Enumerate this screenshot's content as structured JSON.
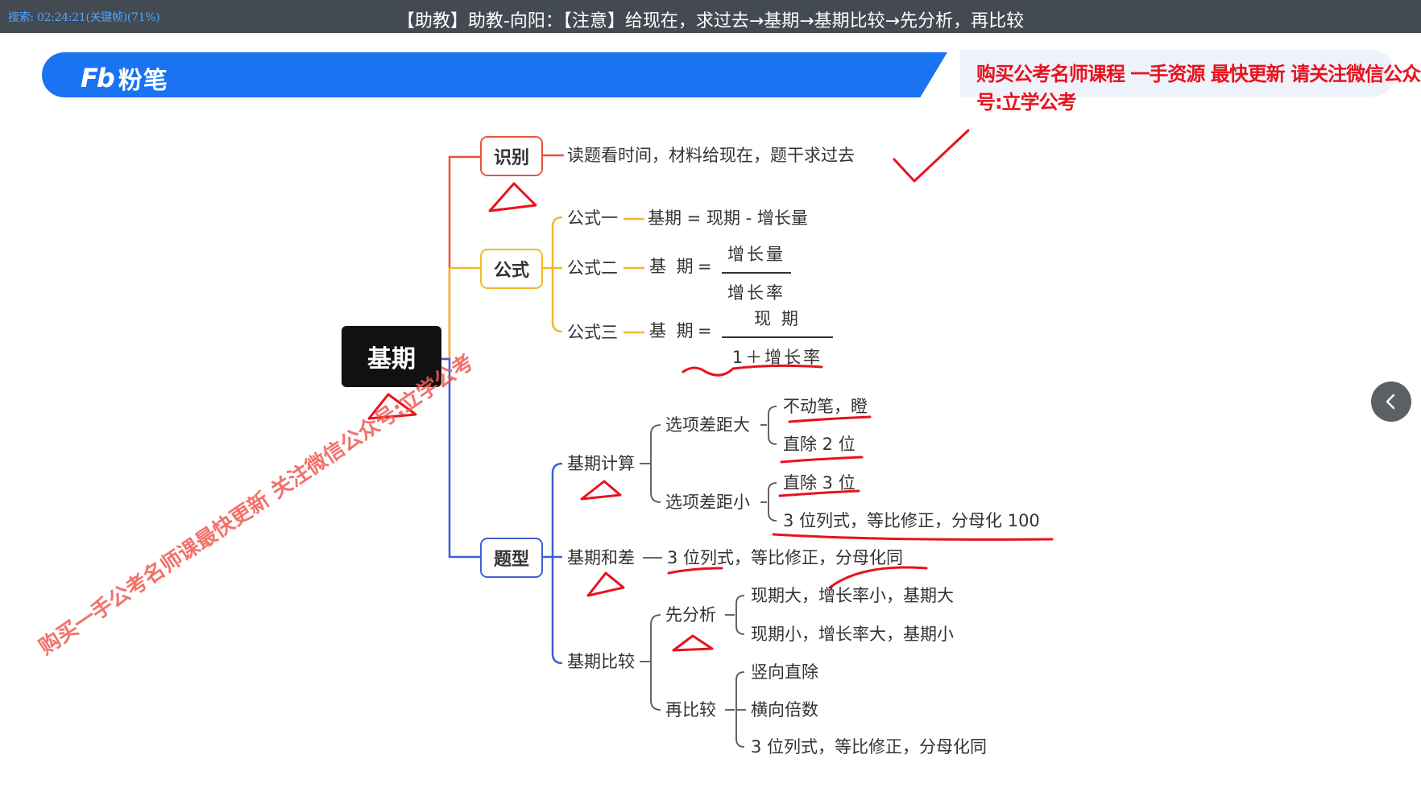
{
  "top_bar": {
    "search_status": "搜索: 02:24:21(关键帧)(71%)",
    "title": "【助教】助教-向阳：【注意】给现在，求过去→基期→基期比较→先分析，再比较"
  },
  "banner": {
    "logo_mark": "Fb",
    "logo_text": "粉笔",
    "promo": "购买公考名师课程 一手资源 最快更新 请关注微信公众号:立学公考"
  },
  "mindmap": {
    "root": "基期",
    "identify": {
      "label": "识别",
      "text": "读题看时间，材料给现在，题干求过去"
    },
    "formula": {
      "label": "公式",
      "f1_name": "公式一",
      "f1_text": "基期 = 现期 - 增长量",
      "f2_name": "公式二",
      "f2_lhs": "基 期",
      "f2_eq": "=",
      "f2_num": "增长量",
      "f2_den": "增长率",
      "f3_name": "公式三",
      "f3_lhs": "基 期",
      "f3_eq": "=",
      "f3_num": "现 期",
      "f3_den": "1＋增长率"
    },
    "types": {
      "label": "题型",
      "calc": {
        "label": "基期计算",
        "big_gap": "选项差距大",
        "big_1": "不动笔，瞪",
        "big_2": "直除 2 位",
        "small_gap": "选项差距小",
        "small_1": "直除 3 位",
        "small_2": "3 位列式，等比修正，分母化 100"
      },
      "sumdiff": {
        "label": "基期和差",
        "text": "3 位列式，等比修正，分母化同"
      },
      "compare": {
        "label": "基期比较",
        "analyze": "先分析",
        "a1": "现期大，增长率小，基期大",
        "a2": "现期小，增长率大，基期小",
        "then": "再比较",
        "c1": "竖向直除",
        "c2": "横向倍数",
        "c3": "3 位列式，等比修正，分母化同"
      }
    }
  },
  "watermark": "购买一手公考名师课最快更新 关注微信公众号:立学公考",
  "colors": {
    "banner_blue": "#1a73f0",
    "identify_red": "#e8553a",
    "formula_yellow": "#f2b82c",
    "types_blue": "#3b5fd6",
    "annotation_red": "#e8121d"
  }
}
